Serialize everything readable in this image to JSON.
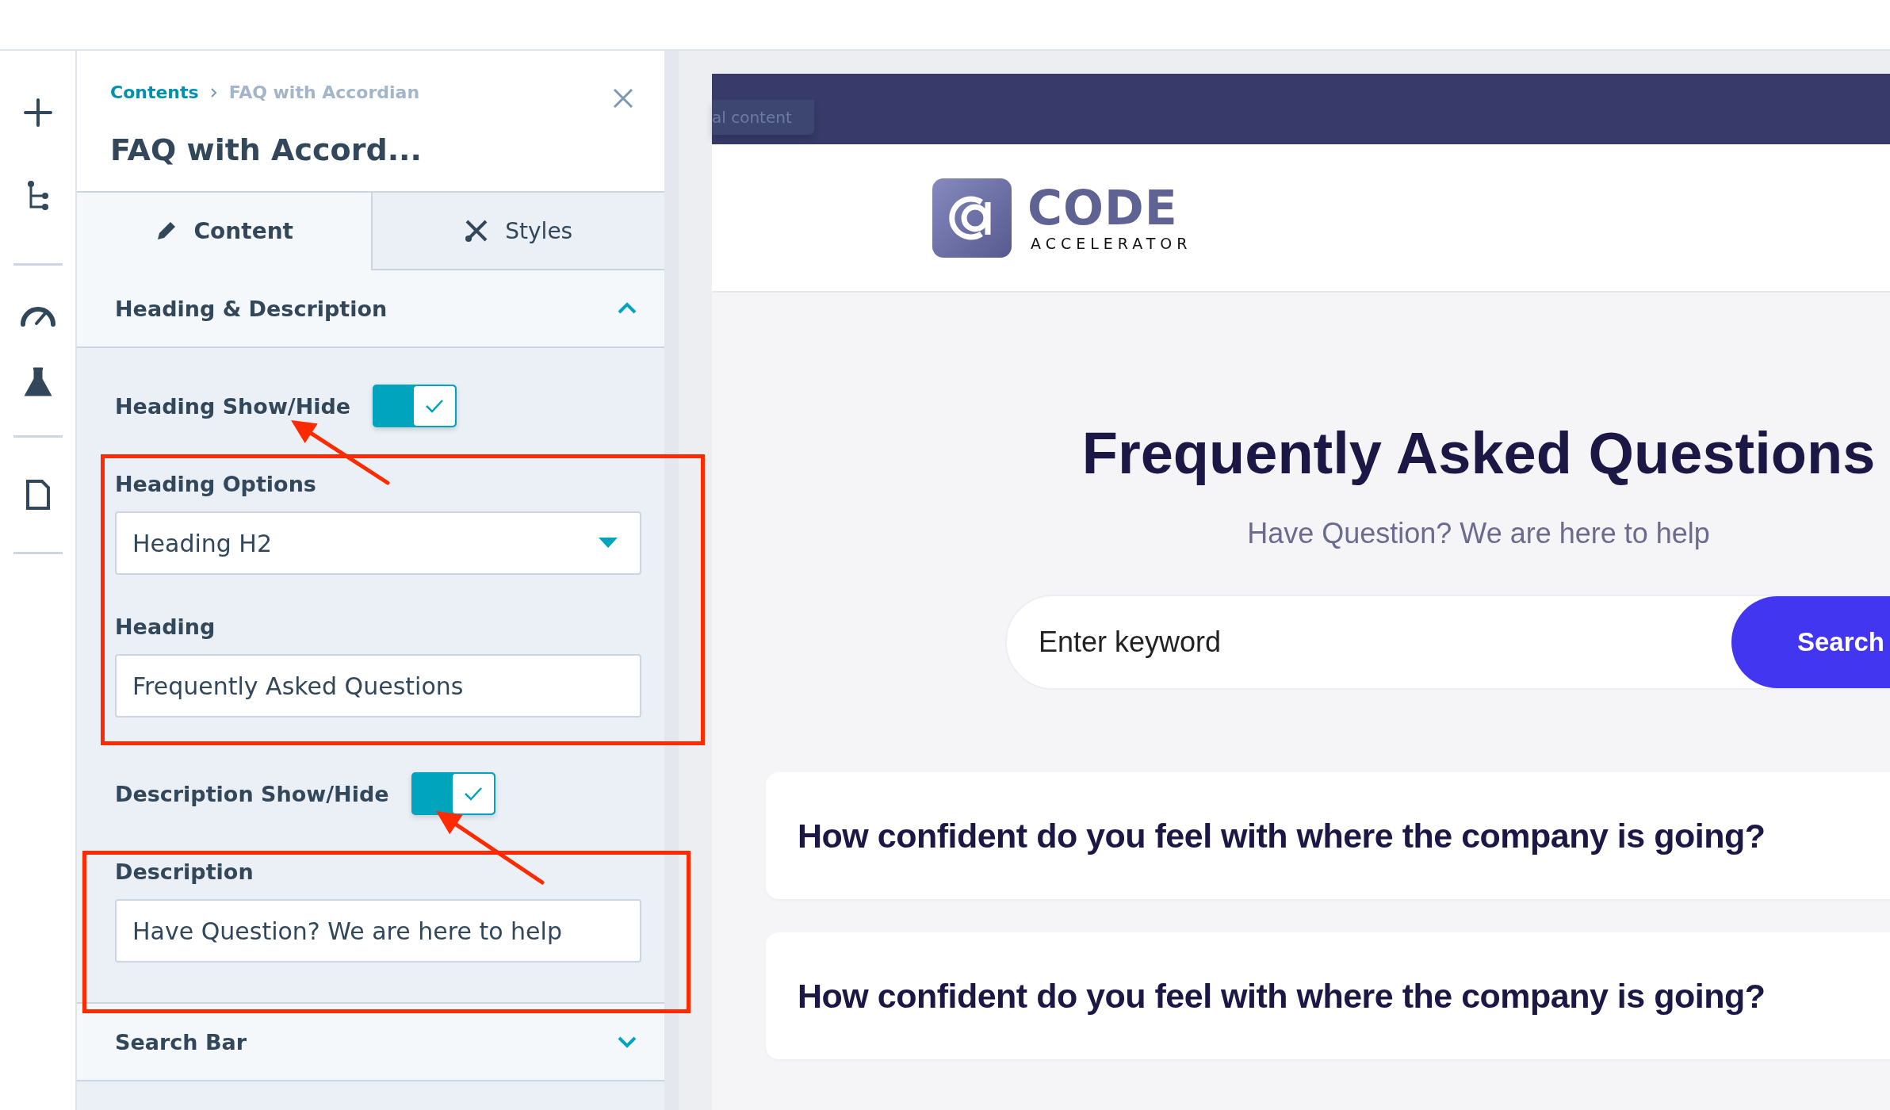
{
  "panel": {
    "breadcrumb": [
      {
        "label": "Contents",
        "selected": false
      },
      {
        "label": "FAQ with Accordian",
        "selected": true
      }
    ],
    "title": "FAQ with Accord...",
    "tabs": [
      {
        "label": "Content",
        "kind": "pencil",
        "selected": true
      },
      {
        "label": "Styles",
        "kind": "brush",
        "selected": false
      }
    ],
    "sections": [
      {
        "title": "Heading & Description",
        "expanded": true,
        "fields": [
          {
            "kind": "toggle",
            "label": "Heading Show/Hide",
            "on": true
          },
          {
            "kind": "select",
            "label": "Heading Options",
            "value": "Heading H2"
          },
          {
            "kind": "text",
            "label": "Heading",
            "value": "Frequently Asked Questions"
          },
          {
            "kind": "toggle",
            "label": "Description Show/Hide",
            "on": true
          },
          {
            "kind": "text",
            "label": "Description",
            "value": "Have Question? We are here to help"
          }
        ]
      },
      {
        "title": "Search Bar",
        "expanded": false
      }
    ]
  },
  "preview": {
    "global_tab": "al content",
    "logo": {
      "name": "CODE",
      "tagline": "ACCELERATOR"
    },
    "heading": "Frequently Asked Questions",
    "description": "Have Question? We are here to help",
    "search": {
      "placeholder": "Enter keyword",
      "button": "Search"
    },
    "questions": [
      "How confident do you feel with where the company is going?",
      "How confident do you feel with where the company is going?"
    ]
  }
}
